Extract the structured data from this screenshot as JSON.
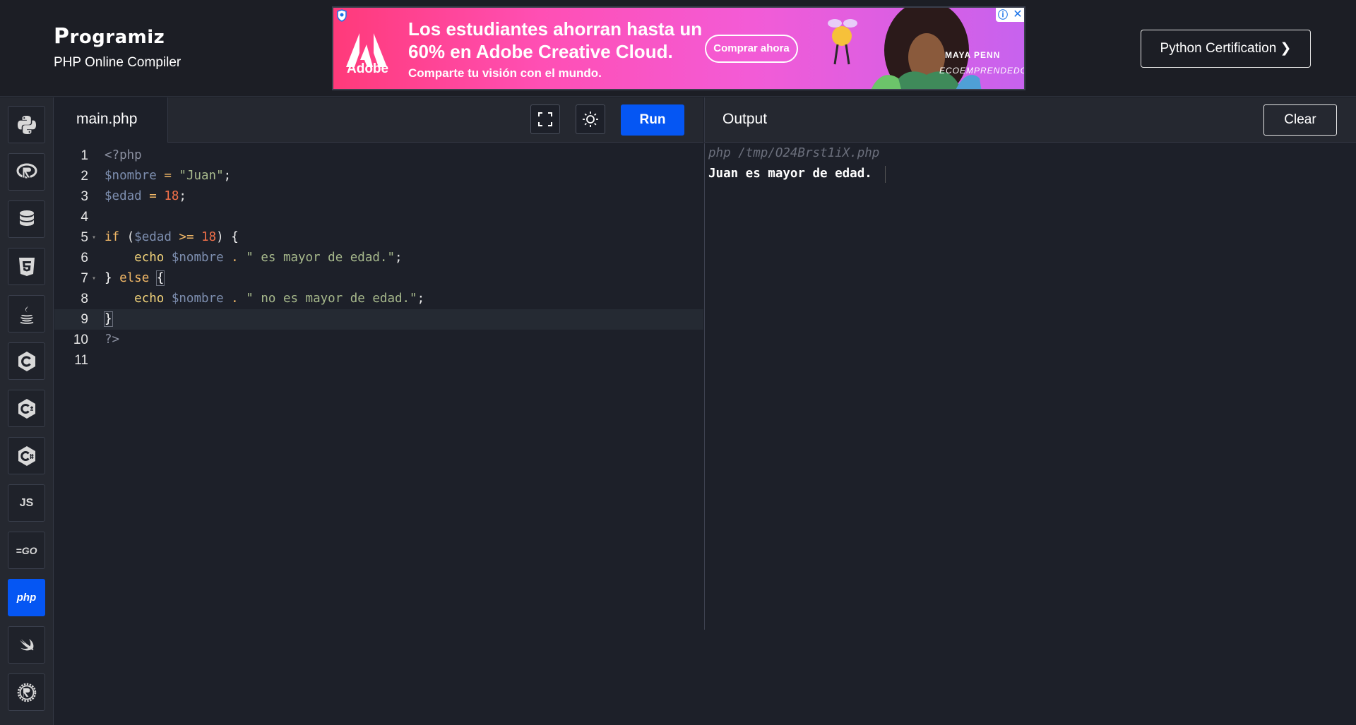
{
  "header": {
    "logo_text": "rogramiz",
    "logo_initial": "P",
    "subtitle": "PHP Online Compiler",
    "cert_button": "Python Certification ❯"
  },
  "ad": {
    "brand": "Adobe",
    "headline": "Los estudiantes ahorran hasta un 60% en Adobe Creative Cloud.",
    "tagline": "Comparte tu visión con el mundo.",
    "cta": "Comprar ahora",
    "person_name": "MAYA PENN",
    "person_role": "ECOEMPRENDEDORA",
    "info_icon": "ⓘ",
    "close_icon": "✕"
  },
  "sidebar": {
    "items": [
      {
        "name": "python",
        "icon": "python-icon",
        "label": ""
      },
      {
        "name": "r",
        "icon": "r-icon",
        "label": ""
      },
      {
        "name": "sql",
        "icon": "database-icon",
        "label": ""
      },
      {
        "name": "html",
        "icon": "html5-icon",
        "label": ""
      },
      {
        "name": "java",
        "icon": "java-icon",
        "label": ""
      },
      {
        "name": "c",
        "icon": "c-icon",
        "label": ""
      },
      {
        "name": "cpp",
        "icon": "cpp-icon",
        "label": ""
      },
      {
        "name": "csharp",
        "icon": "csharp-icon",
        "label": ""
      },
      {
        "name": "js",
        "icon": "js-icon",
        "label": "JS"
      },
      {
        "name": "go",
        "icon": "go-icon",
        "label": "=GO"
      },
      {
        "name": "php",
        "icon": "php-icon",
        "label": "php"
      },
      {
        "name": "swift",
        "icon": "swift-icon",
        "label": ""
      },
      {
        "name": "rust",
        "icon": "rust-icon",
        "label": ""
      }
    ],
    "active": "php"
  },
  "editor": {
    "file_tab": "main.php",
    "run_label": "Run",
    "line_numbers": [
      "1",
      "2",
      "3",
      "4",
      "5",
      "6",
      "7",
      "8",
      "9",
      "10",
      "11"
    ],
    "active_line": 9
  },
  "output": {
    "title": "Output",
    "clear_label": "Clear",
    "command": "php /tmp/O24Brst1iX.php",
    "result": "Juan es mayor de edad."
  },
  "colors": {
    "accent": "#0556f3",
    "background": "#1d2029",
    "panel": "#252830"
  }
}
